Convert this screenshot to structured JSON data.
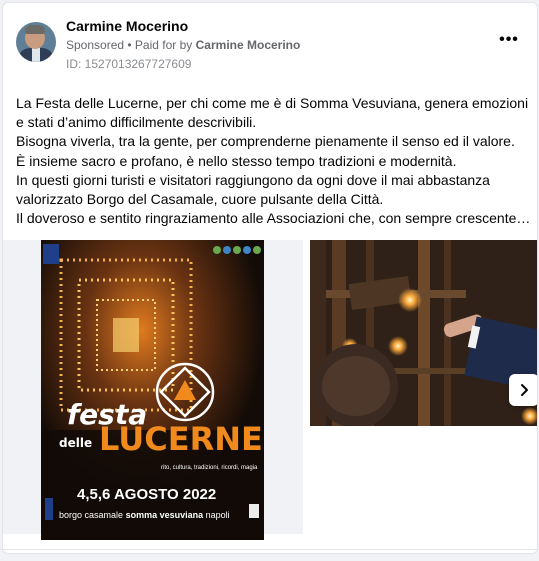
{
  "post": {
    "author": "Carmine Mocerino",
    "sponsored_label": "Sponsored",
    "paid_for_prefix": "• Paid for by",
    "paid_for_name": "Carmine Mocerino",
    "ad_id": "ID: 1527013267727609",
    "more_icon": "more-options-icon",
    "text_lines": [
      "La Festa delle Lucerne, per chi come me è di Somma Vesuviana, genera emozioni",
      "e stati d’animo difficilmente descrivibili.",
      "Bisogna viverla, tra la gente, per comprenderne pienamente il senso ed il valore.",
      "È insieme sacro e profano, è nello stesso tempo tradizioni e modernità.",
      "In questi giorni turisti e visitatori raggiungono da ogni dove il mai abbastanza",
      "valorizzato Borgo del Casamale, cuore pulsante della Città.",
      "Il doveroso e sentito ringraziamento alle Associazioni che, con sempre crescente…"
    ]
  },
  "poster": {
    "title_festa": "festa",
    "title_delle": "delle",
    "title_lucerne": "LUCERNE",
    "tagline": "rito, cultura, tradizioni, ricordi, magia",
    "dates": "4,5,6 AGOSTO 2022",
    "place_prefix": "borgo casamale",
    "place_city": "somma vesuviana",
    "place_suffix": "napoli"
  },
  "carousel": {
    "next_icon": "chevron-right-icon"
  },
  "colors": {
    "accent": "#f08a1d",
    "text": "#050505",
    "muted": "#65676b"
  }
}
